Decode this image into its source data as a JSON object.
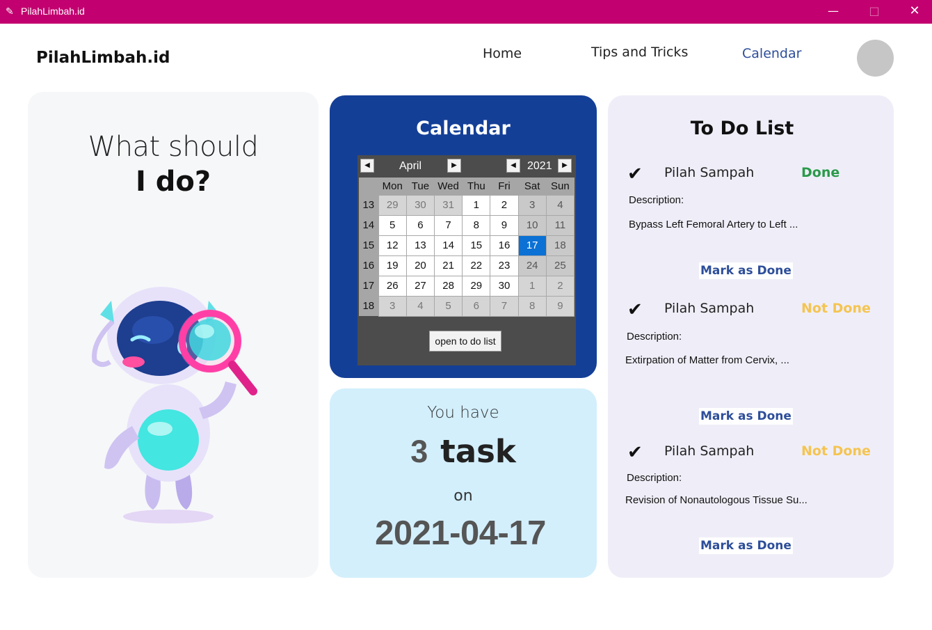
{
  "window": {
    "title": "PilahLimbah.id",
    "minimize": "—",
    "maximize": "□",
    "close": "✕"
  },
  "header": {
    "brand": "PilahLimbah.id",
    "nav": {
      "home": "Home",
      "tips": "Tips and Tricks",
      "calendar": "Calendar"
    }
  },
  "left": {
    "question_line1": "What should",
    "question_line2": "I do?"
  },
  "calendar": {
    "title": "Calendar",
    "month": "April",
    "year": "2021",
    "weekdays": [
      "Mon",
      "Tue",
      "Wed",
      "Thu",
      "Fri",
      "Sat",
      "Sun"
    ],
    "weeks": [
      {
        "no": "13",
        "days": [
          "29",
          "30",
          "31",
          "1",
          "2",
          "3",
          "4"
        ]
      },
      {
        "no": "14",
        "days": [
          "5",
          "6",
          "7",
          "8",
          "9",
          "10",
          "11"
        ]
      },
      {
        "no": "15",
        "days": [
          "12",
          "13",
          "14",
          "15",
          "16",
          "17",
          "18"
        ]
      },
      {
        "no": "16",
        "days": [
          "19",
          "20",
          "21",
          "22",
          "23",
          "24",
          "25"
        ]
      },
      {
        "no": "17",
        "days": [
          "26",
          "27",
          "28",
          "29",
          "30",
          "1",
          "2"
        ]
      },
      {
        "no": "18",
        "days": [
          "3",
          "4",
          "5",
          "6",
          "7",
          "8",
          "9"
        ]
      }
    ],
    "selected": "17",
    "open_button": "open to do list"
  },
  "summary": {
    "you_have": "You have",
    "count": "3",
    "task_word": "task",
    "on": "on",
    "date": "2021-04-17"
  },
  "todo": {
    "title": "To Do List",
    "items": [
      {
        "check": "✔",
        "name": "Pilah Sampah",
        "status": "Done",
        "desc_label": "Description:",
        "desc": "Bypass Left Femoral Artery to Left ...",
        "button": "Mark as Done"
      },
      {
        "check": "✔",
        "name": "Pilah Sampah",
        "status": "Not Done",
        "desc_label": "Description:",
        "desc": "Extirpation of Matter from Cervix, ...",
        "button": "Mark as Done"
      },
      {
        "check": "✔",
        "name": "Pilah Sampah",
        "status": "Not Done",
        "desc_label": "Description:",
        "desc": "Revision of Nonautologous Tissue Su...",
        "button": "Mark as Done"
      }
    ]
  },
  "colors": {
    "titlebar": "#c2006f",
    "calendar_panel": "#143f97",
    "summary_panel": "#d3effc",
    "todo_panel": "#efeef8",
    "done": "#2a9a4a",
    "not_done": "#f5c451",
    "accent": "#2d4e9a"
  }
}
